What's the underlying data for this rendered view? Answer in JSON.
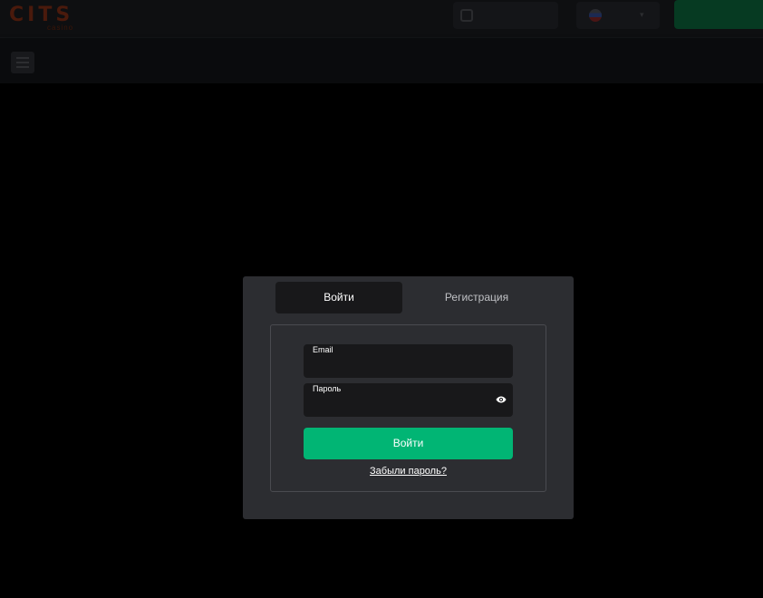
{
  "header": {
    "logo_text": "CITS",
    "logo_subtext": "casino",
    "search_text": "",
    "language_code": "",
    "cta_label": ""
  },
  "subheader": {
    "right_text": ""
  },
  "modal": {
    "tabs": [
      {
        "label": "Войти",
        "active": true
      },
      {
        "label": "Регистрация",
        "active": false
      }
    ],
    "email": {
      "label": "Email",
      "value": "",
      "placeholder": ""
    },
    "password": {
      "label": "Пароль",
      "value": "",
      "placeholder": ""
    },
    "submit_label": "Войти",
    "forgot_label": "Забыли пароль?"
  },
  "colors": {
    "accent": "#01b574",
    "modal_bg": "#2c2d31",
    "field_bg": "#18181a",
    "backdrop": "#000000"
  },
  "icons": {
    "password_toggle": "eye-icon",
    "menu": "hamburger-icon",
    "search": "search-icon",
    "flag": "flag-icon"
  }
}
